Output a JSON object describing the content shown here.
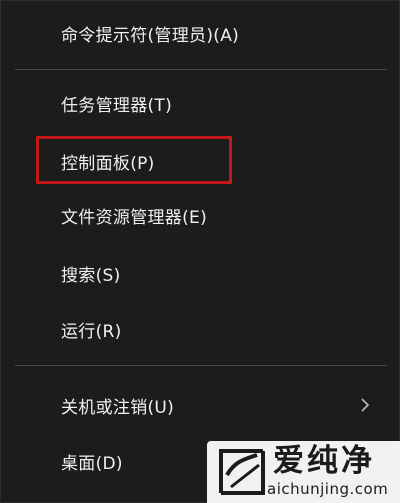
{
  "menu": {
    "items": [
      {
        "label": "命令提示符(管理员)(A)"
      },
      {
        "label": "任务管理器(T)"
      },
      {
        "label": "控制面板(P)",
        "highlighted": true
      },
      {
        "label": "文件资源管理器(E)"
      },
      {
        "label": "搜索(S)"
      },
      {
        "label": "运行(R)"
      },
      {
        "label": "关机或注销(U)",
        "has_submenu": true,
        "submenu_icon": "chevron-right-icon"
      },
      {
        "label": "桌面(D)"
      }
    ]
  },
  "highlight_color": "#c4171c",
  "watermark": {
    "title": "爱纯净",
    "url": "aichunjing.com"
  }
}
